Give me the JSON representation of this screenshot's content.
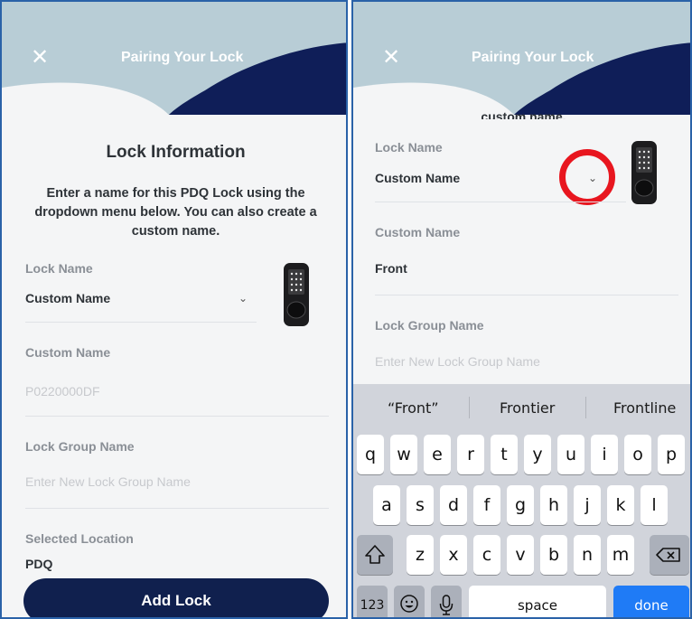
{
  "colors": {
    "header_light": "#b8cdd6",
    "header_dark": "#0f1e58",
    "button": "#10204e",
    "annotation_circle": "#e8161f",
    "done_key": "#1f7bf6"
  },
  "left_screen": {
    "header": {
      "close_icon": "close-icon",
      "title": "Pairing Your Lock"
    },
    "heading": "Lock Information",
    "description_lines": [
      "Enter a name for this PDQ Lock using the",
      "dropdown menu below. You can also create a",
      "custom name."
    ],
    "lock_name": {
      "label": "Lock Name",
      "value": "Custom Name"
    },
    "custom_name": {
      "label": "Custom Name",
      "placeholder": "P0220000DF"
    },
    "lock_group": {
      "label": "Lock Group Name",
      "placeholder": "Enter New Lock Group Name"
    },
    "location": {
      "label": "Selected Location",
      "value": "PDQ"
    },
    "add_button": "Add Lock"
  },
  "right_screen": {
    "header": {
      "close_icon": "close-icon",
      "title": "Pairing Your Lock"
    },
    "partial_text": "custom name.",
    "lock_name": {
      "label": "Lock Name",
      "value": "Custom Name"
    },
    "custom_name": {
      "label": "Custom Name",
      "value": "Front"
    },
    "lock_group": {
      "label": "Lock Group Name",
      "placeholder": "Enter New Lock Group Name"
    },
    "keyboard": {
      "suggestions": [
        "“Front”",
        "Frontier",
        "Frontline"
      ],
      "row1": [
        "q",
        "w",
        "e",
        "r",
        "t",
        "y",
        "u",
        "i",
        "o",
        "p"
      ],
      "row2": [
        "a",
        "s",
        "d",
        "f",
        "g",
        "h",
        "j",
        "k",
        "l"
      ],
      "row3": [
        "z",
        "x",
        "c",
        "v",
        "b",
        "n",
        "m"
      ],
      "shift_icon": "shift-icon",
      "delete_icon": "backspace-icon",
      "numbers_key": "123",
      "emoji_icon": "emoji-icon",
      "mic_icon": "microphone-icon",
      "space_key": "space",
      "done_key": "done"
    }
  }
}
